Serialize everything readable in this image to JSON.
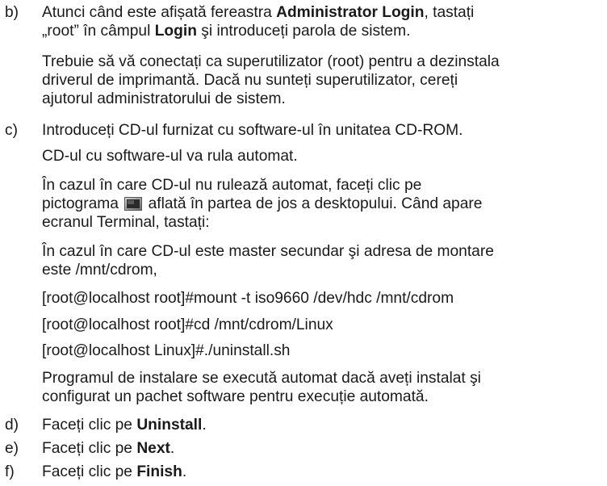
{
  "steps": {
    "b": {
      "marker": "b)",
      "line1": {
        "t1": "Atunci când este afișată fereastra ",
        "bold1": "Administrator Login",
        "t2": ", tastați"
      },
      "line2": {
        "t1": "„root” în câmpul ",
        "bold1": "Login",
        "t2": " şi introduceți parola de sistem."
      },
      "note_lines": [
        "Trebuie să vă conectați ca superutilizator (root) pentru a dezinstala",
        "driverul de imprimantă. Dacă nu sunteți superutilizator, cereți",
        "ajutorul administratorului de sistem."
      ]
    },
    "c": {
      "marker": "c)",
      "intro": "Introduceți CD-ul furnizat cu software-ul în unitatea CD-ROM.",
      "autorun": "CD-ul cu software-ul va rula automat.",
      "manual_line1": "În cazul în care CD-ul nu rulează automat, faceți clic pe",
      "manual_line2": {
        "t1": "pictograma ",
        "t2": " aflată în partea de jos a desktopului. Când apare"
      },
      "manual_line3": "ecranul Terminal, tastați:",
      "mount_line1": "În cazul în care CD-ul este master secundar şi adresa de montare",
      "mount_line2": "este /mnt/cdrom,",
      "commands": [
        "[root@localhost root]#mount -t iso9660 /dev/hdc /mnt/cdrom",
        "[root@localhost root]#cd /mnt/cdrom/Linux",
        "[root@localhost Linux]#./uninstall.sh"
      ],
      "outro_lines": [
        "Programul de instalare se execută automat dacă aveți instalat şi",
        "configurat un pachet software pentru execuție automată."
      ]
    },
    "d": {
      "marker": "d)",
      "t1": "Faceți clic pe ",
      "bold1": "Uninstall",
      "t2": "."
    },
    "e": {
      "marker": "e)",
      "t1": "Faceți clic pe ",
      "bold1": "Next",
      "t2": "."
    },
    "f": {
      "marker": "f)",
      "t1": "Faceți clic pe ",
      "bold1": "Finish",
      "t2": "."
    }
  },
  "icon": "terminal-icon"
}
